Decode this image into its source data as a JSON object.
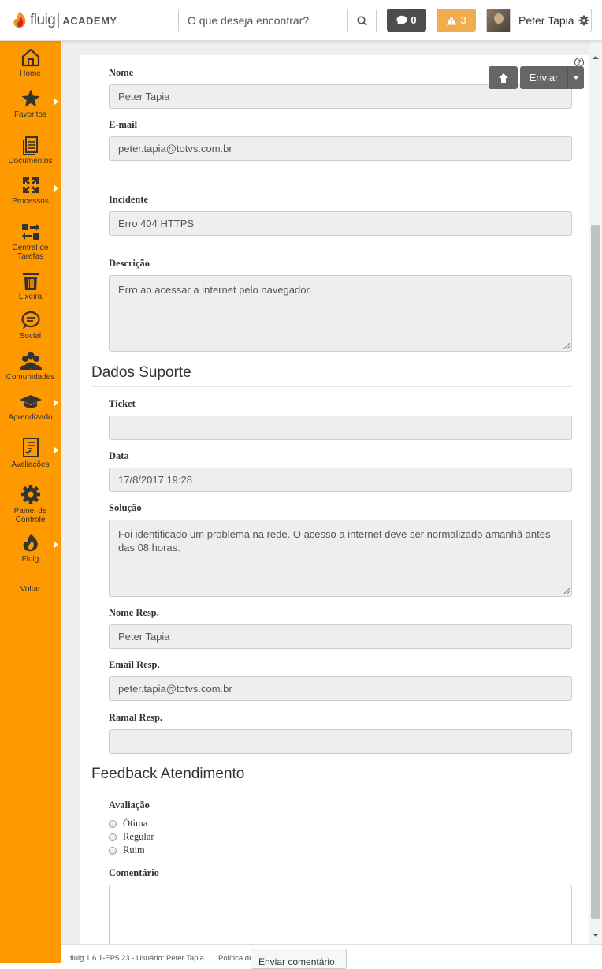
{
  "header": {
    "logo_text": "fluig",
    "logo_academy": "ACADEMY",
    "search_placeholder": "O que deseja encontrar?",
    "messages_count": "0",
    "alerts_count": "3",
    "user_name": "Peter Tapia"
  },
  "sidebar": {
    "items": [
      {
        "label": "Home",
        "icon": "home-icon"
      },
      {
        "label": "Favoritos",
        "icon": "star-icon"
      },
      {
        "label": "Documentos",
        "icon": "documents-icon"
      },
      {
        "label": "Processos",
        "icon": "processes-icon"
      },
      {
        "label": "Central de Tarefas",
        "icon": "tasks-icon"
      },
      {
        "label": "Lixeira",
        "icon": "trash-icon"
      },
      {
        "label": "Social",
        "icon": "chat-icon"
      },
      {
        "label": "Comunidades",
        "icon": "communities-icon"
      },
      {
        "label": "Aprendizado",
        "icon": "graduation-icon"
      },
      {
        "label": "Avaliações",
        "icon": "evaluation-icon"
      },
      {
        "label": "Painel de Controle",
        "icon": "gear-icon"
      },
      {
        "label": "Fluig",
        "icon": "fluig-icon"
      },
      {
        "label": "Voltar",
        "icon": ""
      }
    ]
  },
  "toolbar": {
    "send_label": "Enviar"
  },
  "form": {
    "nome_label": "Nome",
    "nome_value": "Peter Tapia",
    "email_label": "E-mail",
    "email_value": "peter.tapia@totvs.com.br",
    "incidente_label": "Incidente",
    "incidente_value": "Erro 404 HTTPS",
    "descricao_label": "Descrição",
    "descricao_value": "Erro ao acessar a internet pelo navegador.",
    "section_suporte": "Dados Suporte",
    "ticket_label": "Ticket",
    "ticket_value": "",
    "data_label": "Data",
    "data_value": "17/8/2017 19:28",
    "solucao_label": "Solução",
    "solucao_value": "Foi identificado um problema na rede. O acesso a internet deve ser normalizado amanhã antes das 08 horas.",
    "nome_resp_label": "Nome Resp.",
    "nome_resp_value": "Peter Tapia",
    "email_resp_label": "Email Resp.",
    "email_resp_value": "peter.tapia@totvs.com.br",
    "ramal_resp_label": "Ramal Resp.",
    "ramal_resp_value": "",
    "section_feedback": "Feedback Atendimento",
    "avaliacao_label": "Avaliação",
    "avaliacao_options": [
      "Ótima",
      "Regular",
      "Ruim"
    ],
    "comentario_label": "Comentário"
  },
  "footer": {
    "version_text": "fluig 1.6.1-EP5 23 - Usuário: Peter Tapia",
    "policy_text": "Política de",
    "send_comment_label": "Enviar comentário"
  }
}
